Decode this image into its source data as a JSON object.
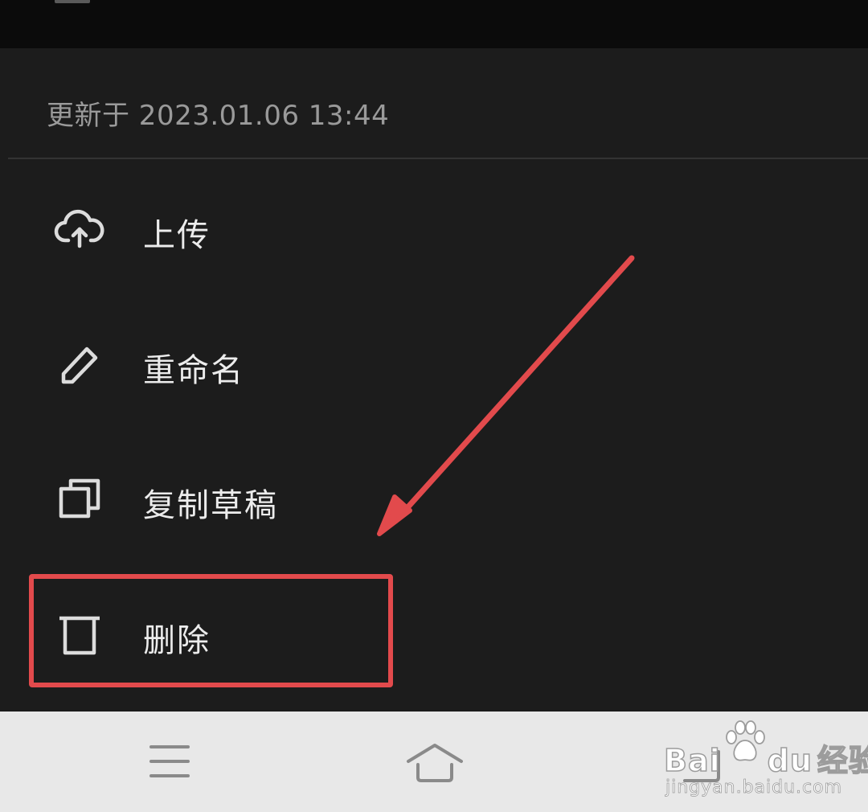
{
  "sheet": {
    "updated_text": "更新于 2023.01.06 13:44",
    "menu": [
      {
        "label": "上传",
        "icon": "cloud-upload-icon"
      },
      {
        "label": "重命名",
        "icon": "pencil-icon"
      },
      {
        "label": "复制草稿",
        "icon": "copy-icon"
      },
      {
        "label": "删除",
        "icon": "trash-icon"
      }
    ]
  },
  "annotation": {
    "highlight_color": "#e24a4c"
  },
  "navbar": {
    "buttons": [
      {
        "icon": "menu-icon"
      },
      {
        "icon": "home-icon"
      },
      {
        "icon": "back-icon"
      }
    ]
  },
  "watermark": {
    "brand_left": "Bai",
    "brand_right": "du",
    "brand_cn": "经验",
    "url": "jingyan.baidu.com"
  },
  "colors": {
    "sheet_bg": "#1c1c1c",
    "text_primary": "#ececec",
    "text_secondary": "#9a9a9a",
    "navbar_bg": "#e8e8e8"
  }
}
